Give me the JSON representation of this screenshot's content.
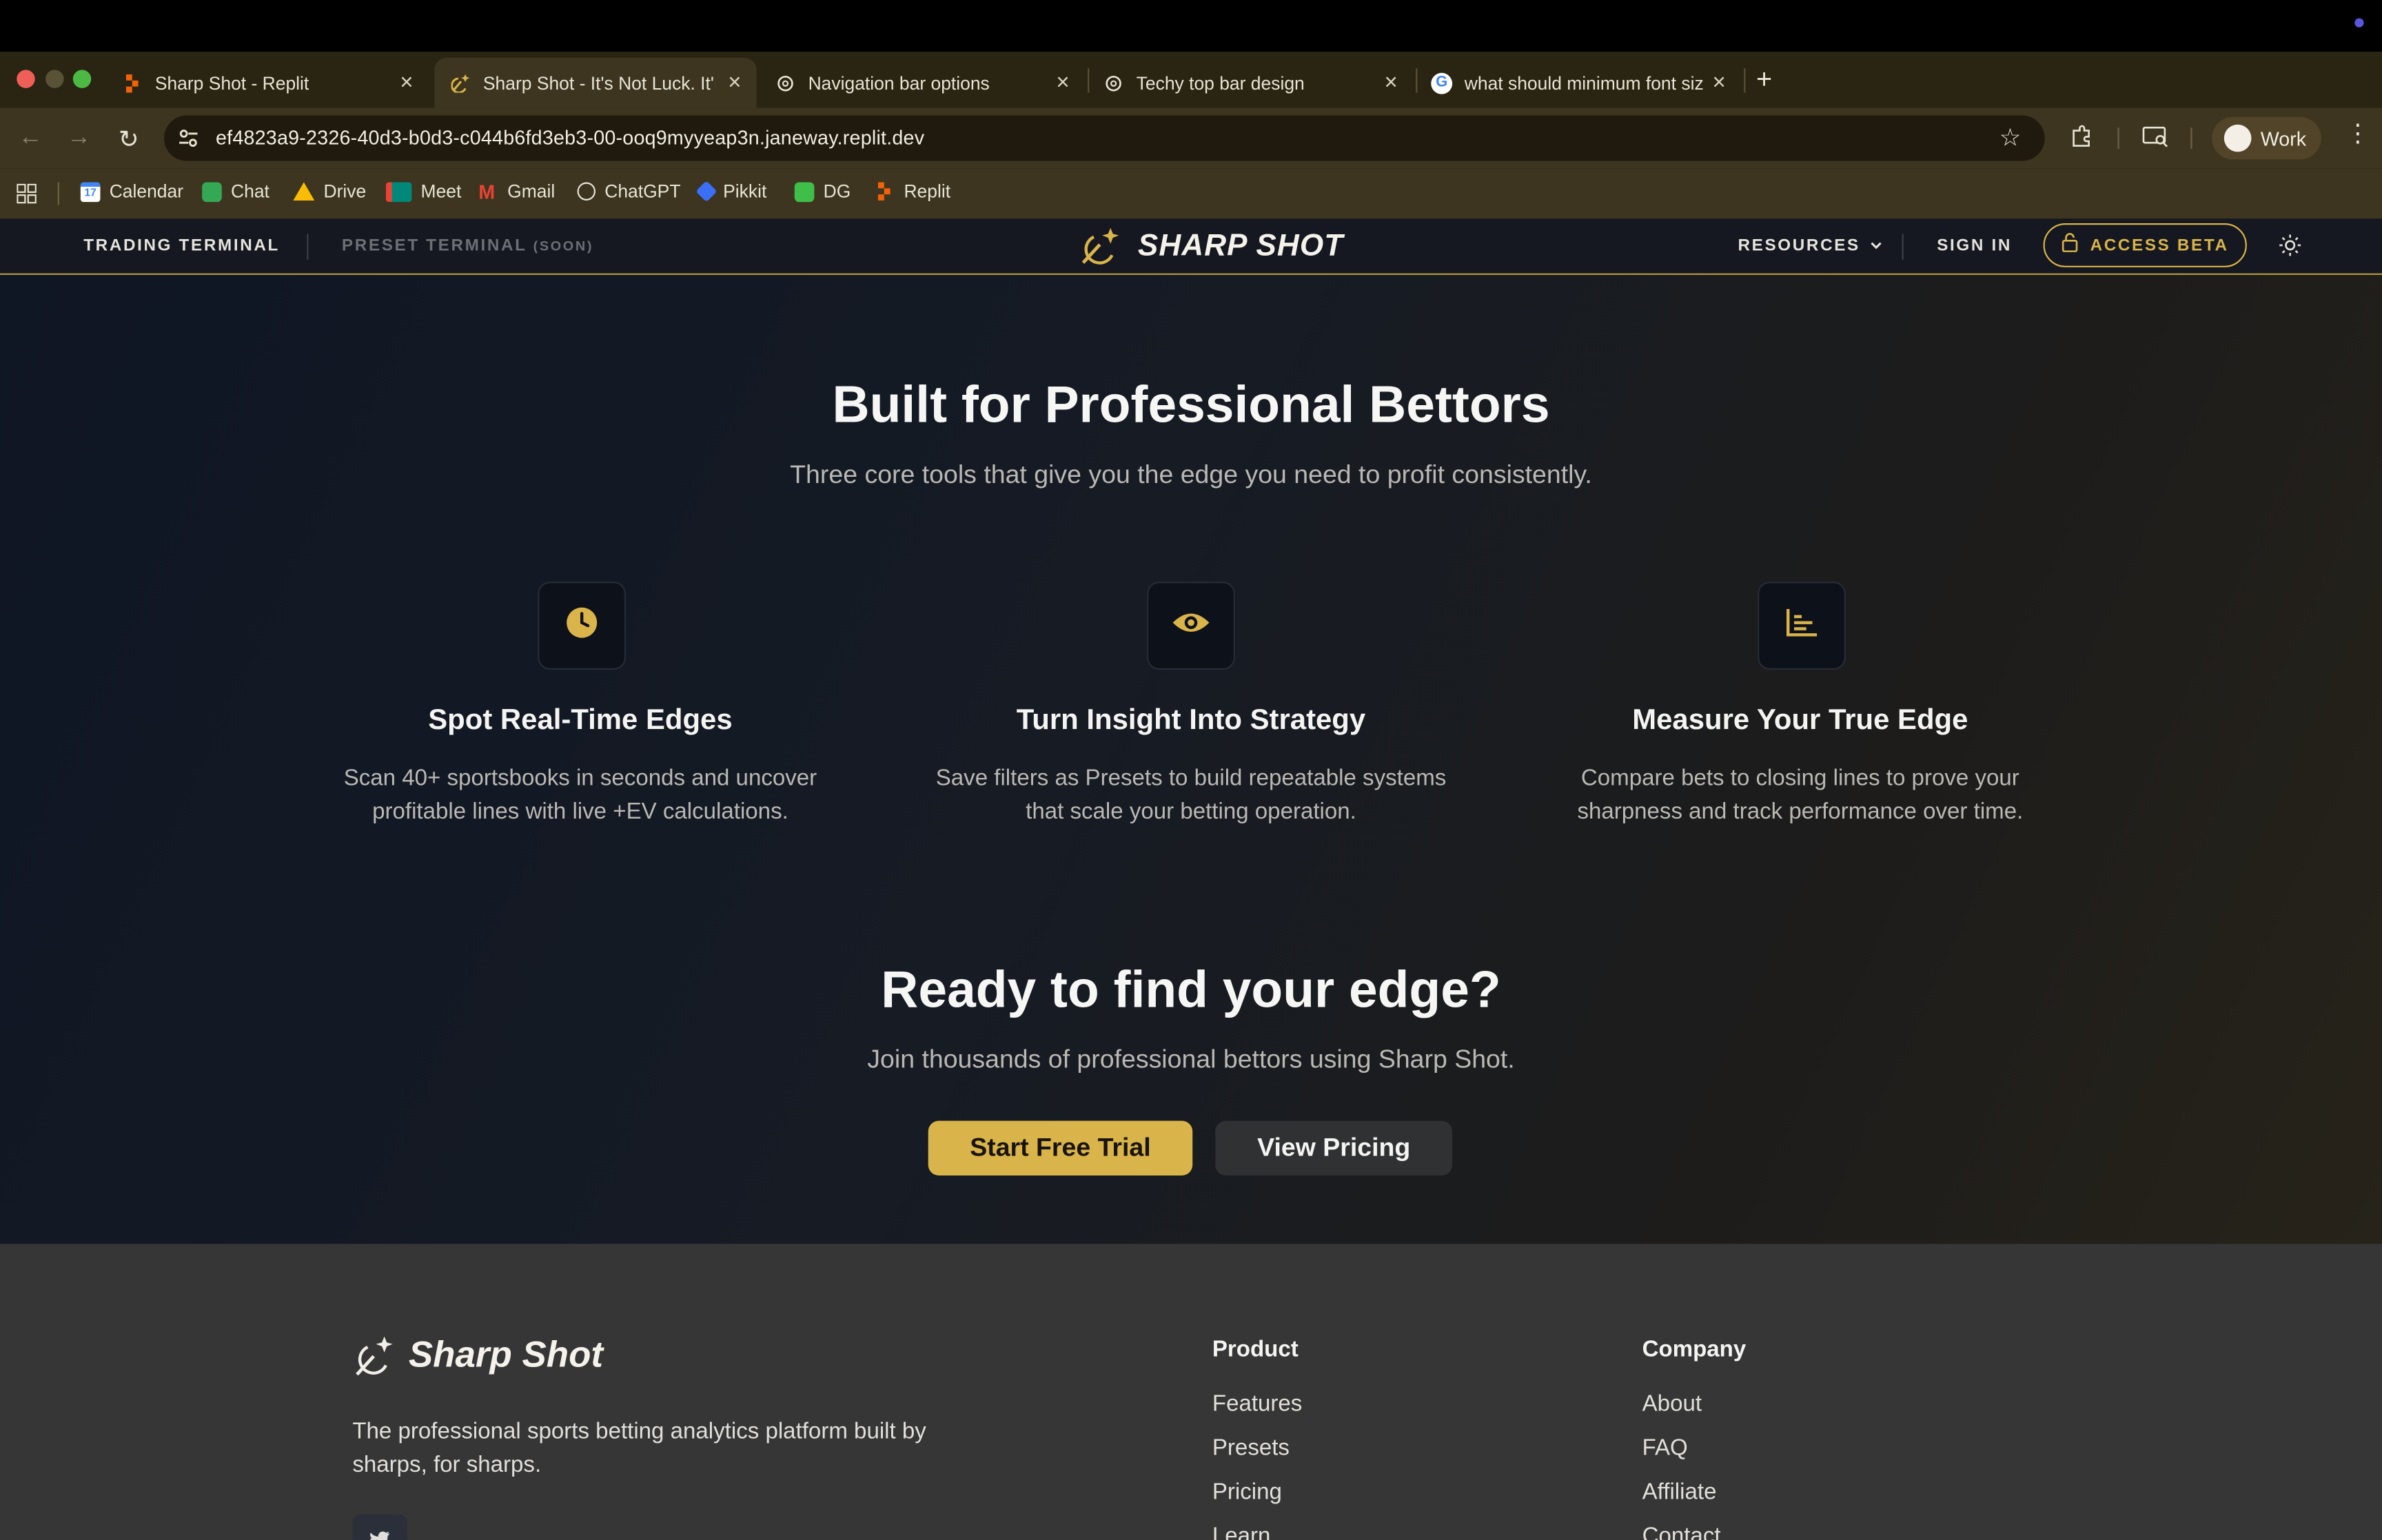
{
  "browser": {
    "tabs": [
      {
        "title": "Sharp Shot - Replit"
      },
      {
        "title": "Sharp Shot - It's Not Luck. It'"
      },
      {
        "title": "Navigation bar options"
      },
      {
        "title": "Techy top bar design"
      },
      {
        "title": "what should minimum font siz"
      }
    ],
    "url": "ef4823a9-2326-40d3-b0d3-c044b6fd3eb3-00-ooq9myyeap3n.janeway.replit.dev",
    "profile_label": "Work",
    "bookmarks": [
      "Calendar",
      "Chat",
      "Drive",
      "Meet",
      "Gmail",
      "ChatGPT",
      "Pikkit",
      "DG",
      "Replit"
    ],
    "calendar_day": "17"
  },
  "site_nav": {
    "trading_terminal": "TRADING TERMINAL",
    "preset_terminal": "PRESET TERMINAL",
    "preset_soon": "(SOON)",
    "logo_text": "SHARP SHOT",
    "resources": "RESOURCES",
    "sign_in": "SIGN IN",
    "access_beta": "ACCESS BETA"
  },
  "features_section": {
    "title": "Built for Professional Bettors",
    "subtitle": "Three core tools that give you the edge you need to profit consistently.",
    "features": [
      {
        "icon": "clock-icon",
        "title": "Spot Real-Time Edges",
        "desc_line1": "Scan 40+ sportsbooks in seconds and uncover",
        "desc_line2": "profitable lines with live +EV calculations."
      },
      {
        "icon": "eye-icon",
        "title": "Turn Insight Into Strategy",
        "desc_line1": "Save filters as Presets to build repeatable systems",
        "desc_line2": "that scale your betting operation."
      },
      {
        "icon": "chart-icon",
        "title": "Measure Your True Edge",
        "desc_line1": "Compare bets to closing lines to prove your",
        "desc_line2": "sharpness and track performance over time."
      }
    ]
  },
  "cta": {
    "title": "Ready to find your edge?",
    "subtitle": "Join thousands of professional bettors using Sharp Shot.",
    "primary": "Start Free Trial",
    "secondary": "View Pricing"
  },
  "footer": {
    "brand": "Sharp Shot",
    "tagline_line1": "The professional sports betting analytics platform built by",
    "tagline_line2": "sharps, for sharps.",
    "columns": [
      {
        "heading": "Product",
        "links": [
          "Features",
          "Presets",
          "Pricing",
          "Learn"
        ]
      },
      {
        "heading": "Company",
        "links": [
          "About",
          "FAQ",
          "Affiliate",
          "Contact"
        ]
      }
    ]
  },
  "colors": {
    "accent_gold": "#d9b44a",
    "nav_bg": "#151820",
    "footer_bg": "#363636"
  }
}
